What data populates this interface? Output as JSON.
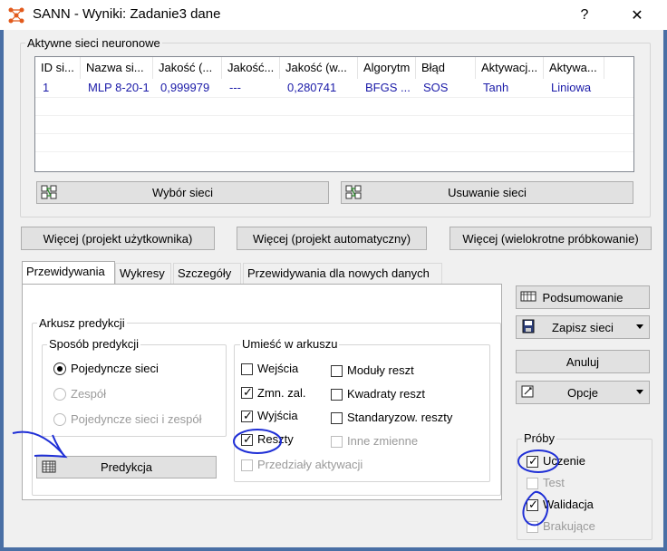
{
  "window": {
    "title": "SANN - Wyniki: Zadanie3 dane",
    "help_glyph": "?",
    "close_glyph": "✕"
  },
  "active_networks": {
    "group_label": "Aktywne sieci neuronowe",
    "columns": [
      "ID si...",
      "Nazwa si...",
      "Jakość (...",
      "Jakość...",
      "Jakość (w...",
      "Algorytm",
      "Błąd",
      "Aktywacj...",
      "Aktywa..."
    ],
    "rows": [
      [
        "1",
        "MLP 8-20-1",
        "0,999979",
        "---",
        "0,280741",
        "BFGS ...",
        "SOS",
        "Tanh",
        "Liniowa"
      ]
    ],
    "select_button": "Wybór sieci",
    "remove_button": "Usuwanie sieci"
  },
  "more_buttons": {
    "user": "Więcej (projekt użytkownika)",
    "auto": "Więcej (projekt automatyczny)",
    "resampling": "Więcej (wielokrotne próbkowanie)"
  },
  "tabs": [
    "Przewidywania",
    "Wykresy",
    "Szczegóły",
    "Przewidywania dla nowych danych"
  ],
  "prediction_sheet": {
    "group_label": "Arkusz predykcji",
    "method_group": "Sposób predykcji",
    "method_options": [
      {
        "label": "Pojedyncze sieci",
        "selected": true,
        "enabled": true
      },
      {
        "label": "Zespół",
        "selected": false,
        "enabled": false
      },
      {
        "label": "Pojedyncze sieci i zespół",
        "selected": false,
        "enabled": false
      }
    ],
    "place_group": "Umieść w arkuszu",
    "place_left": [
      {
        "label": "Wejścia",
        "checked": false,
        "enabled": true
      },
      {
        "label": "Zmn. zal.",
        "checked": true,
        "enabled": true
      },
      {
        "label": "Wyjścia",
        "checked": true,
        "enabled": true
      },
      {
        "label": "Reszty",
        "checked": true,
        "enabled": true
      },
      {
        "label": "Przedziały aktywacji",
        "checked": false,
        "enabled": false
      }
    ],
    "place_right": [
      {
        "label": "Moduły reszt",
        "checked": false,
        "enabled": true
      },
      {
        "label": "Kwadraty reszt",
        "checked": false,
        "enabled": true
      },
      {
        "label": "Standaryzow. reszty",
        "checked": false,
        "enabled": true
      },
      {
        "label": "Inne zmienne",
        "checked": false,
        "enabled": false
      }
    ],
    "predict_button": "Predykcja"
  },
  "side": {
    "summary_button": "Podsumowanie",
    "save_button": "Zapisz sieci",
    "cancel_button": "Anuluj",
    "options_button": "Opcje",
    "samples_group": "Próby",
    "samples": [
      {
        "label": "Uczenie",
        "checked": true,
        "enabled": true
      },
      {
        "label": "Test",
        "checked": false,
        "enabled": false
      },
      {
        "label": "Walidacja",
        "checked": true,
        "enabled": true
      },
      {
        "label": "Brakujące",
        "checked": false,
        "enabled": false
      }
    ]
  },
  "colors": {
    "border_accent": "#4a6fa5",
    "ink_annotation": "#1f2fd6",
    "table_text": "#1a1aa8"
  }
}
